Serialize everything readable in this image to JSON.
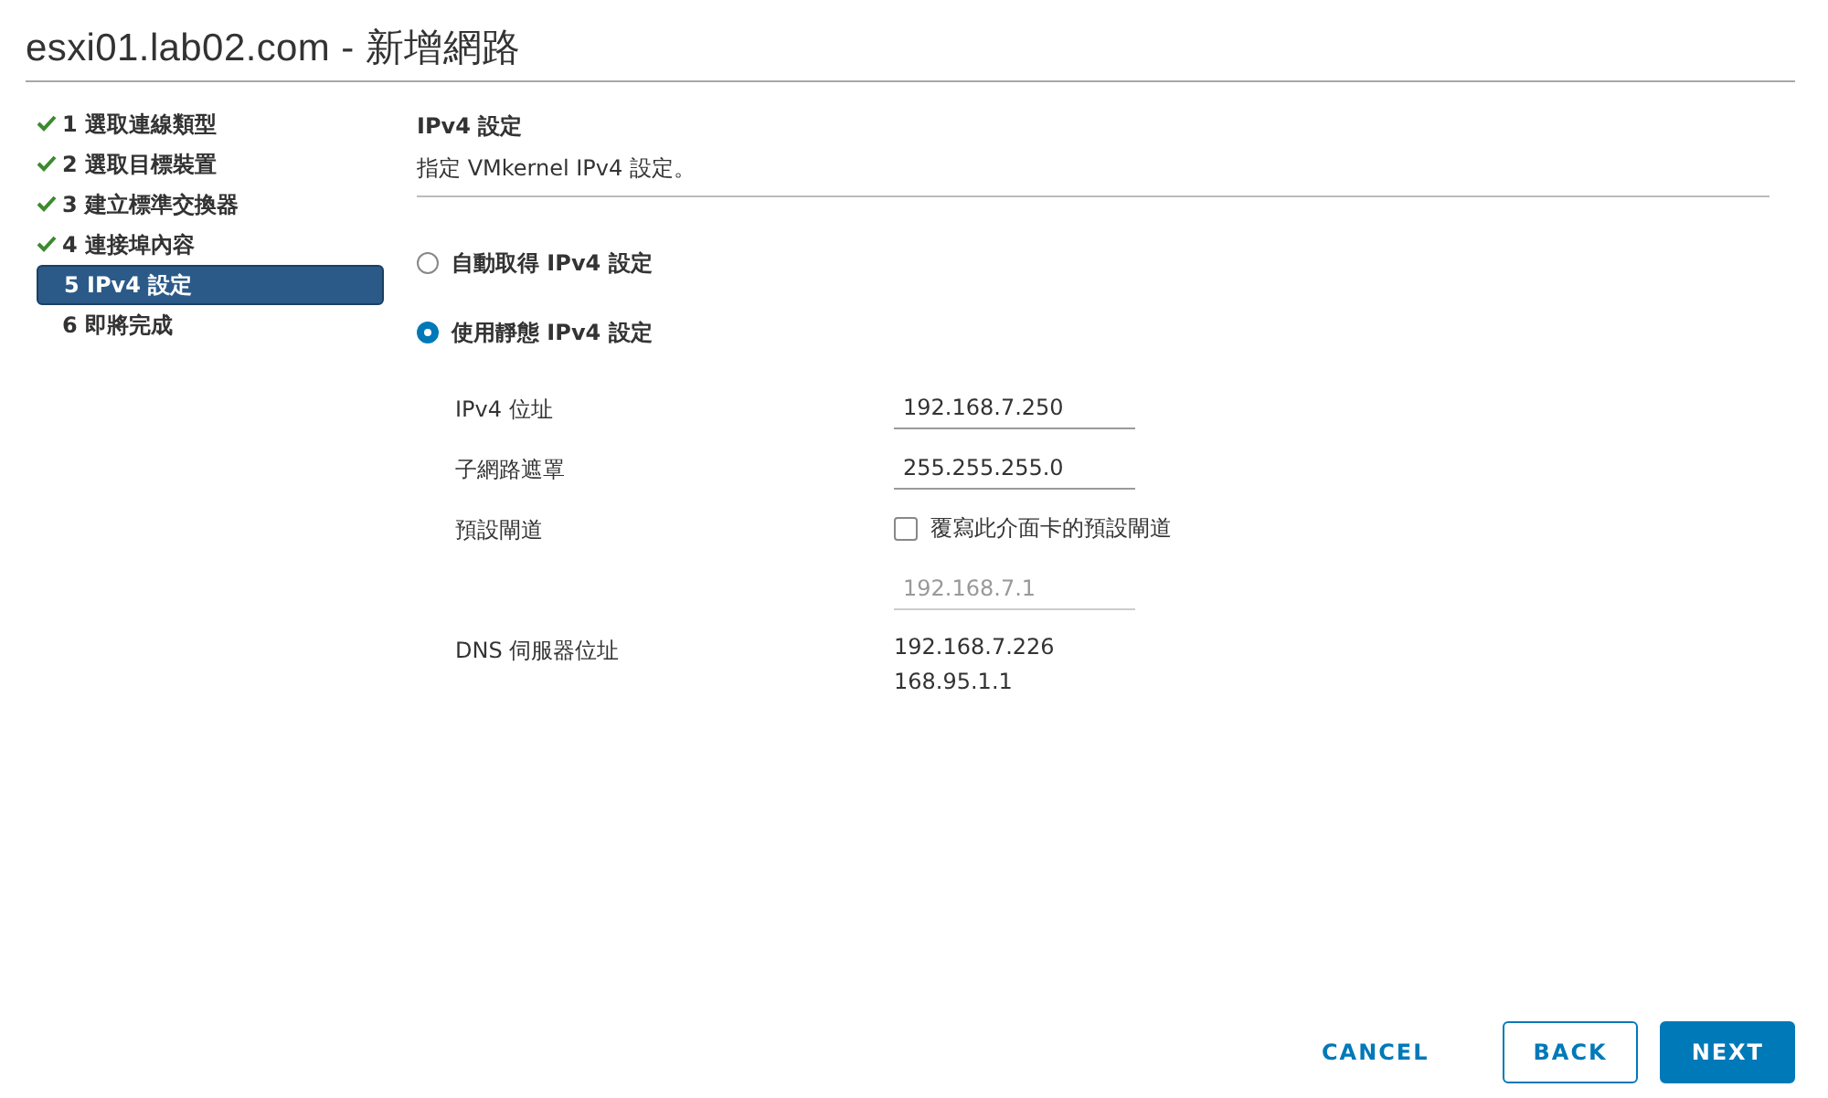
{
  "window": {
    "title": "esxi01.lab02.com - 新增網路"
  },
  "steps": [
    {
      "label": "1 選取連線類型",
      "completed": true,
      "selected": false
    },
    {
      "label": "2 選取目標裝置",
      "completed": true,
      "selected": false
    },
    {
      "label": "3 建立標準交換器",
      "completed": true,
      "selected": false
    },
    {
      "label": "4 連接埠內容",
      "completed": true,
      "selected": false
    },
    {
      "label": "5 IPv4 設定",
      "completed": false,
      "selected": true
    },
    {
      "label": "6 即將完成",
      "completed": false,
      "selected": false
    }
  ],
  "page": {
    "heading": "IPv4 設定",
    "description": "指定 VMkernel IPv4 設定。"
  },
  "options": [
    {
      "label": "自動取得 IPv4 設定",
      "selected": false
    },
    {
      "label": "使用靜態 IPv4 設定",
      "selected": true
    }
  ],
  "fields": [
    {
      "kind": "input",
      "label": "IPv4 位址",
      "value": "192.168.7.250",
      "disabled": false
    },
    {
      "kind": "input",
      "label": "子網路遮罩",
      "value": "255.255.255.0",
      "disabled": false
    },
    {
      "kind": "checkbox",
      "label": "預設閘道",
      "text": "覆寫此介面卡的預設閘道",
      "checked": false
    },
    {
      "kind": "input",
      "value": "192.168.7.1",
      "disabled": true
    },
    {
      "kind": "list",
      "label": "DNS 伺服器位址",
      "values": [
        "192.168.7.226",
        "168.95.1.1"
      ]
    }
  ],
  "buttons": [
    {
      "label": "CANCEL",
      "kind": "link"
    },
    {
      "label": "BACK",
      "kind": "outline"
    },
    {
      "label": "NEXT",
      "kind": "primary"
    }
  ]
}
